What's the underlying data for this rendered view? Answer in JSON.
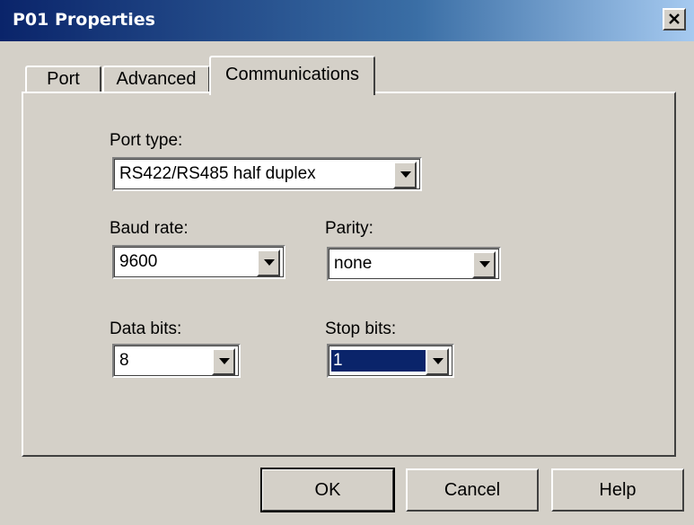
{
  "window": {
    "title": "P01 Properties",
    "close_label": "×"
  },
  "tabs": [
    {
      "label": "Port",
      "active": false
    },
    {
      "label": "Advanced",
      "active": false
    },
    {
      "label": "Communications",
      "active": true
    }
  ],
  "communications": {
    "port_type": {
      "label": "Port type:",
      "value": "RS422/RS485 half duplex"
    },
    "baud_rate": {
      "label": "Baud rate:",
      "value": "9600"
    },
    "parity": {
      "label": "Parity:",
      "value": "none"
    },
    "data_bits": {
      "label": "Data bits:",
      "value": "8"
    },
    "stop_bits": {
      "label": "Stop bits:",
      "value": "1",
      "focused": true
    }
  },
  "buttons": {
    "ok": "OK",
    "cancel": "Cancel",
    "help": "Help"
  },
  "colors": {
    "title_bar_start": "#0a246a",
    "title_bar_end": "#a6caf0",
    "dialog_face": "#d4d0c8",
    "selection": "#0a246a"
  },
  "icons": {
    "close": "close-icon",
    "dropdown": "chevron-down-icon"
  }
}
